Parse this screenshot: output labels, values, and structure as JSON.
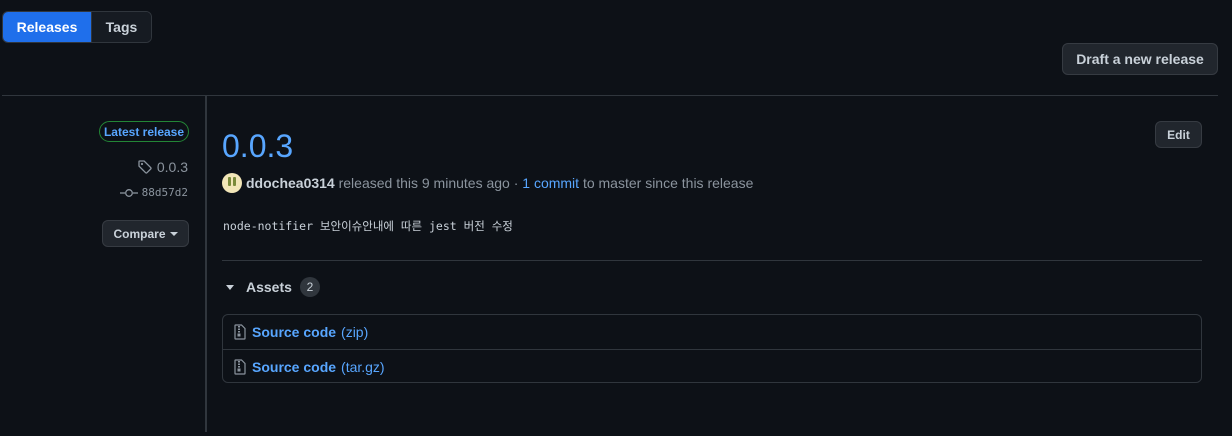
{
  "tabs": {
    "releases_label": "Releases",
    "tags_label": "Tags"
  },
  "toolbar": {
    "draft_label": "Draft a new release"
  },
  "sidebar": {
    "latest_badge": "Latest release",
    "tag": "0.0.3",
    "commit": "88d57d2",
    "compare_label": "Compare"
  },
  "release": {
    "title": "0.0.3",
    "edit_label": "Edit",
    "author": "ddochea0314",
    "released_text": " released this 9 minutes ago · ",
    "commits_link": "1 commit",
    "since_text": " to master since this release",
    "notes": "node-notifier 보안이슈안내에 따른 jest 버전 수정"
  },
  "assets": {
    "label": "Assets",
    "count": "2",
    "items": [
      {
        "name": "Source code",
        "ext": "(zip)"
      },
      {
        "name": "Source code",
        "ext": "(tar.gz)"
      }
    ]
  },
  "colors": {
    "accent": "#1f6feb",
    "link": "#58a6ff",
    "badge_border": "#238636",
    "background": "#0d1117"
  },
  "icons": {
    "tag": "tag-icon",
    "commit": "git-commit-icon",
    "zip": "file-zip-icon",
    "caret": "triangle-down-icon"
  }
}
